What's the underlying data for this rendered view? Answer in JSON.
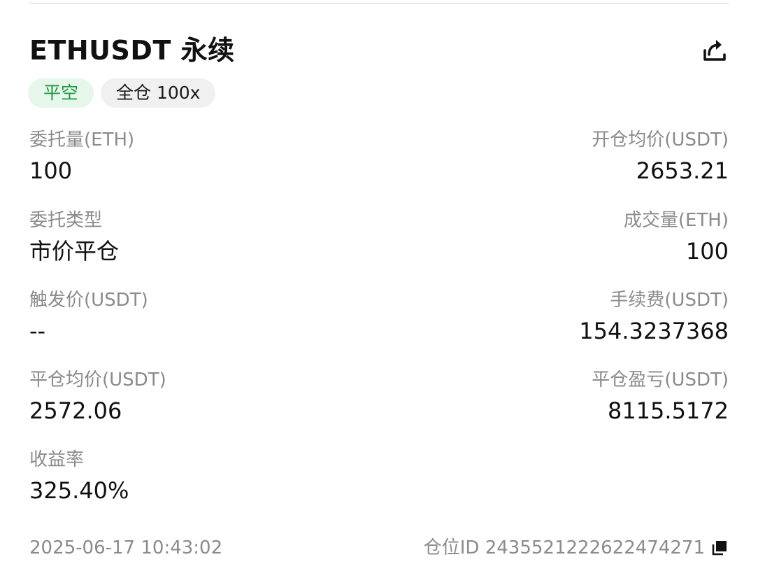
{
  "header": {
    "symbol": "ETHUSDT 永续",
    "share_icon": "share-icon"
  },
  "tags": {
    "side": "平空",
    "margin": "全仓 100x"
  },
  "fields": {
    "order_qty": {
      "label": "委托量(ETH)",
      "value": "100"
    },
    "open_avg": {
      "label": "开仓均价(USDT)",
      "value": "2653.21"
    },
    "order_type": {
      "label": "委托类型",
      "value": "市价平仓"
    },
    "filled_qty": {
      "label": "成交量(ETH)",
      "value": "100"
    },
    "trigger": {
      "label": "触发价(USDT)",
      "value": "--"
    },
    "fee": {
      "label": "手续费(USDT)",
      "value": "154.3237368"
    },
    "close_avg": {
      "label": "平仓均价(USDT)",
      "value": "2572.06"
    },
    "close_pnl": {
      "label": "平仓盈亏(USDT)",
      "value": "8115.5172"
    },
    "roi": {
      "label": "收益率",
      "value": "325.40%"
    }
  },
  "footer": {
    "timestamp": "2025-06-17 10:43:02",
    "position_id": "仓位ID 2435521222622474271",
    "copy_icon": "copy-icon"
  },
  "colors": {
    "green_text": "#1e9a40",
    "green_bg": "#e6f6ea",
    "label_gray": "#8b8b8b",
    "text": "#111111"
  }
}
